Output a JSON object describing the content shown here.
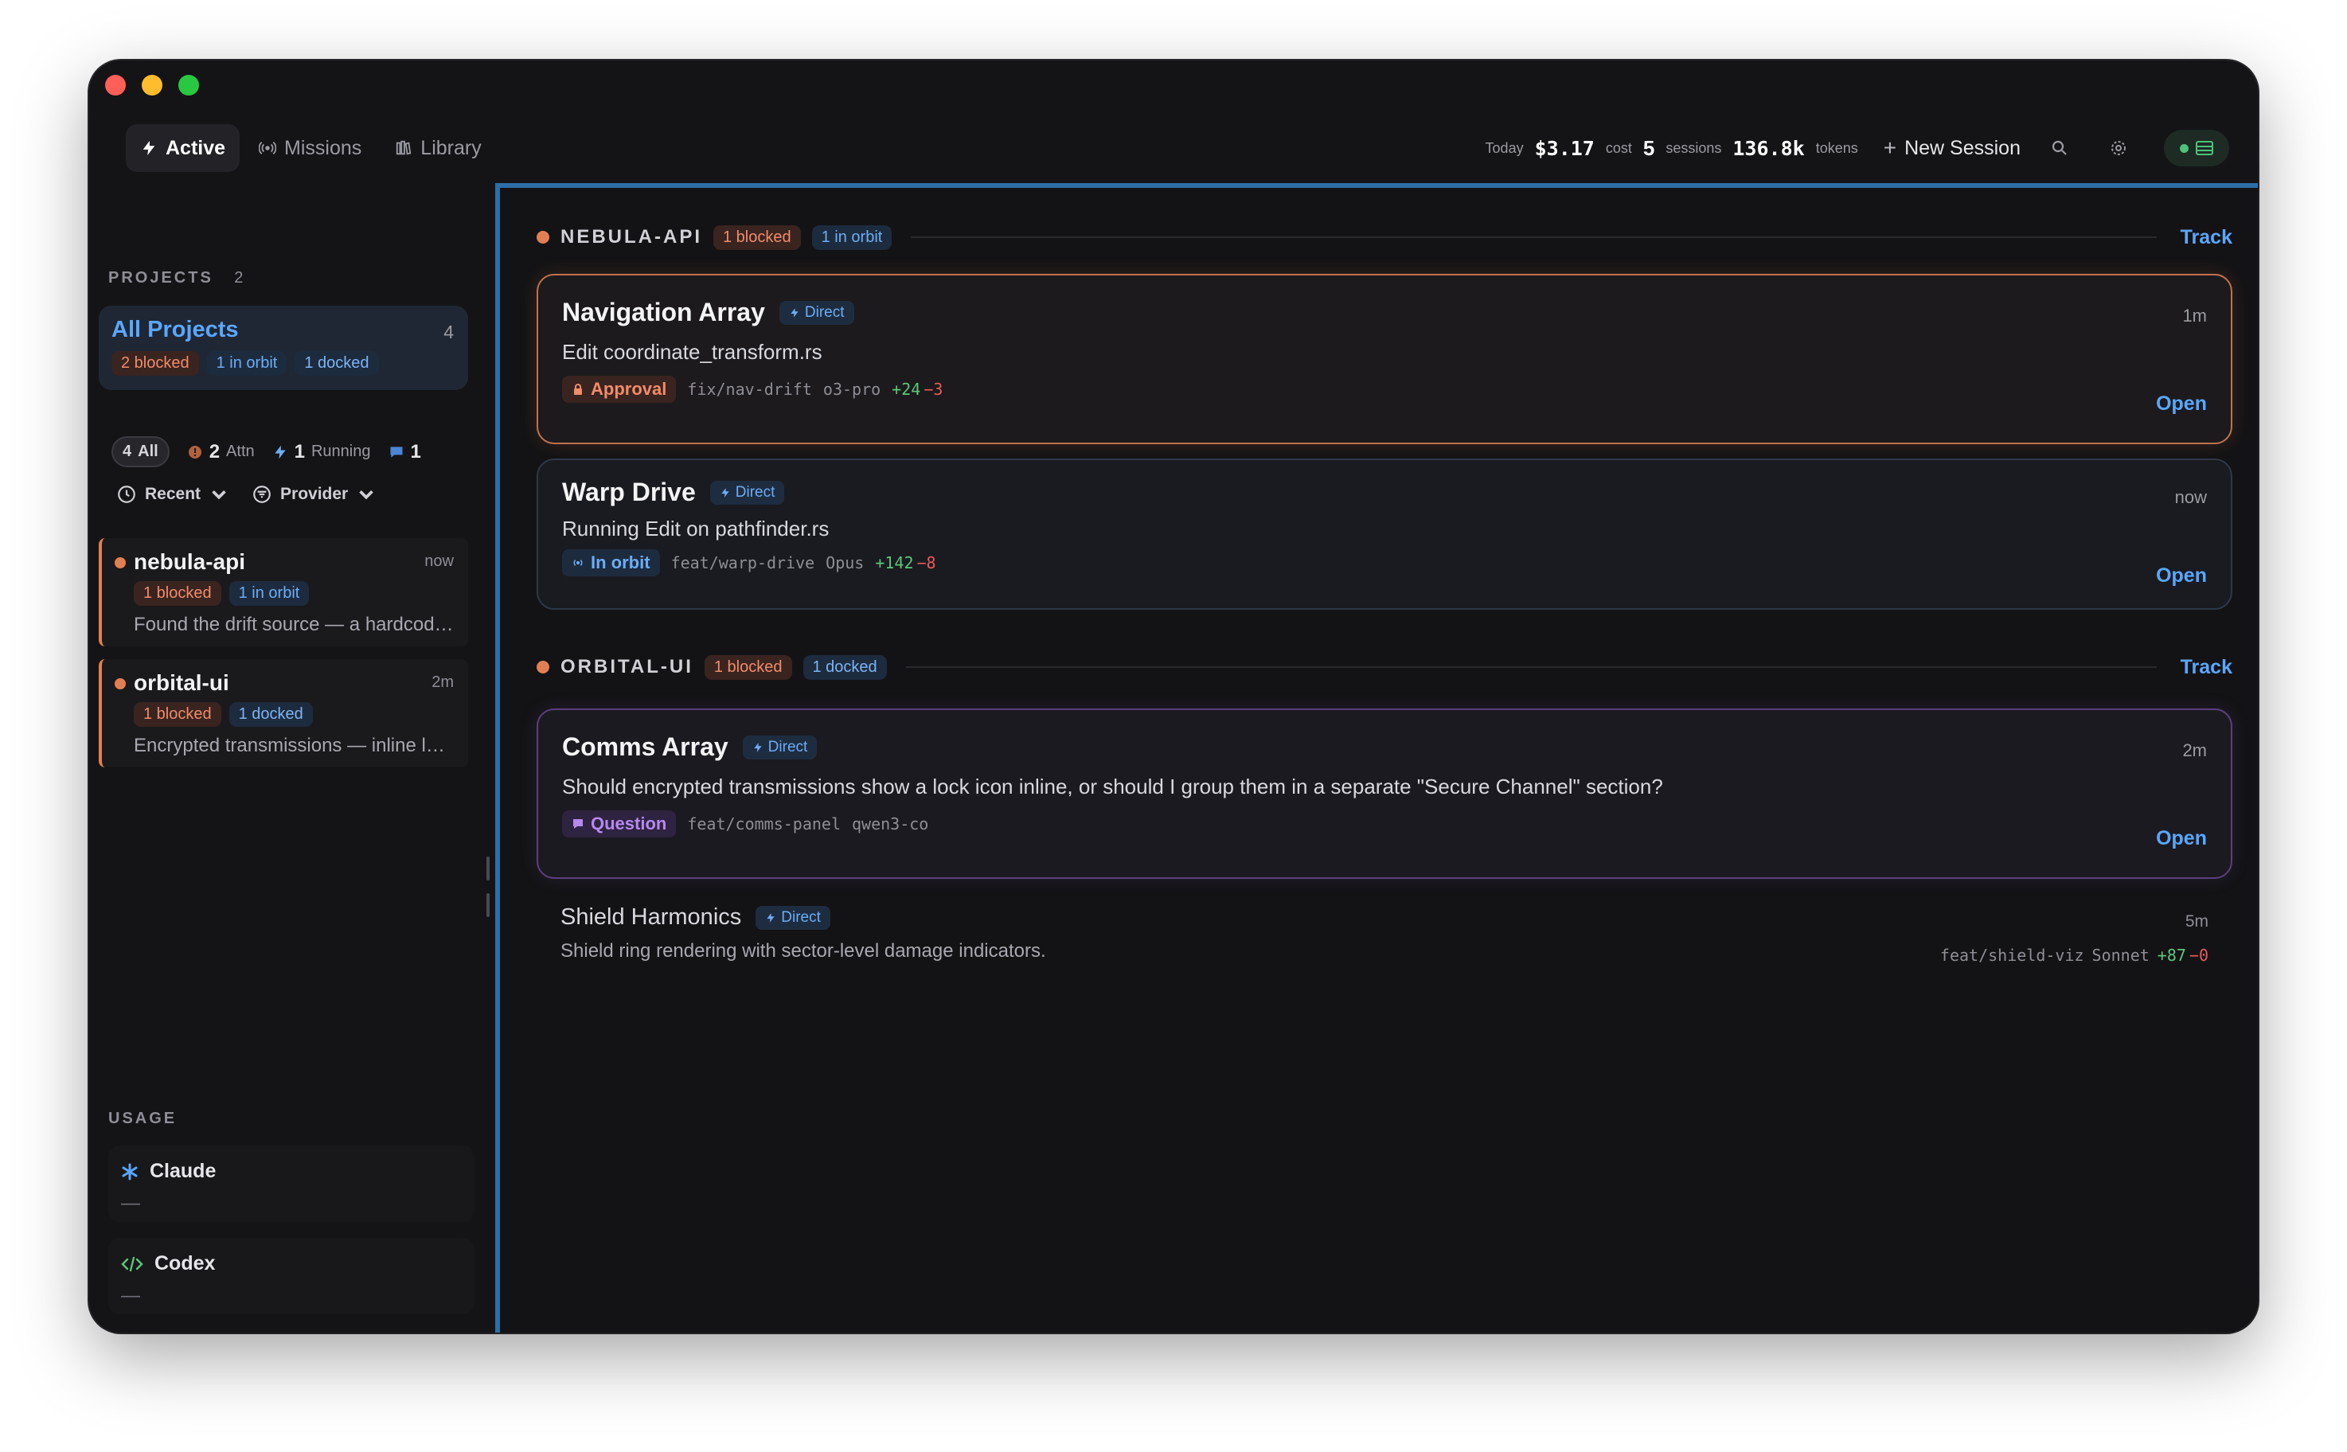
{
  "topbar": {
    "tabs": [
      {
        "label": "Active",
        "icon": "bolt-icon"
      },
      {
        "label": "Missions",
        "icon": "radio-icon"
      },
      {
        "label": "Library",
        "icon": "library-icon"
      }
    ],
    "stats": {
      "today_label": "Today",
      "cost_value": "$3.17",
      "cost_label": "cost",
      "sessions_value": "5",
      "sessions_label": "sessions",
      "tokens_value": "136.8k",
      "tokens_label": "tokens"
    },
    "new_session": "New Session"
  },
  "sidebar": {
    "projects_label": "PROJECTS",
    "projects_count": "2",
    "all_projects": {
      "title": "All Projects",
      "count": "4",
      "tags": [
        "2 blocked",
        "1 in orbit",
        "1 docked"
      ]
    },
    "filters": {
      "all": {
        "count": "4",
        "label": "All"
      },
      "attn": {
        "count": "2",
        "label": "Attn"
      },
      "running": {
        "count": "1",
        "label": "Running"
      },
      "messages": {
        "count": "1"
      }
    },
    "sorts": {
      "recent": "Recent",
      "provider": "Provider"
    },
    "projects": [
      {
        "name": "nebula-api",
        "time": "now",
        "tags": [
          "1 blocked",
          "1 in orbit"
        ],
        "desc": "Found the drift source — a hardcoded offset in the transform"
      },
      {
        "name": "orbital-ui",
        "time": "2m",
        "tags": [
          "1 blocked",
          "1 docked"
        ],
        "desc": "Encrypted transmissions — inline lock icon or separate section"
      }
    ],
    "usage_label": "USAGE",
    "usage": [
      {
        "name": "Claude",
        "value": "—"
      },
      {
        "name": "Codex",
        "value": "—"
      }
    ]
  },
  "main": {
    "groups": [
      {
        "name": "NEBULA-API",
        "tags": [
          "1 blocked",
          "1 in orbit"
        ],
        "track": "Track"
      },
      {
        "name": "ORBITAL-UI",
        "tags": [
          "1 blocked",
          "1 docked"
        ],
        "track": "Track"
      }
    ],
    "sessions": [
      {
        "title": "Navigation Array",
        "mode": "Direct",
        "time": "1m",
        "body": "Edit coordinate_transform.rs",
        "status": "Approval",
        "branch": "fix/nav-drift",
        "model": "o3-pro",
        "added": "+24",
        "removed": "−3",
        "action": "Open"
      },
      {
        "title": "Warp Drive",
        "mode": "Direct",
        "time": "now",
        "body": "Running Edit on pathfinder.rs",
        "status": "In orbit",
        "branch": "feat/warp-drive",
        "model": "Opus",
        "added": "+142",
        "removed": "−8",
        "action": "Open"
      },
      {
        "title": "Comms Array",
        "mode": "Direct",
        "time": "2m",
        "body": "Should encrypted transmissions show a lock icon inline, or should I group them in a separate \"Secure Channel\" section?",
        "status": "Question",
        "branch": "feat/comms-panel",
        "model": "qwen3-co",
        "action": "Open"
      },
      {
        "title": "Shield Harmonics",
        "mode": "Direct",
        "time": "5m",
        "body": "Shield ring rendering with sector-level damage indicators.",
        "branch": "feat/shield-viz",
        "model": "Sonnet",
        "added": "+87",
        "removed": "−0"
      }
    ]
  },
  "colors": {
    "accent": "#5aa7ff",
    "blocked": "#f08c6a",
    "orbit": "#6cadf5",
    "question": "#b788f0",
    "added": "#5cc77a",
    "removed": "#e85a5a"
  }
}
